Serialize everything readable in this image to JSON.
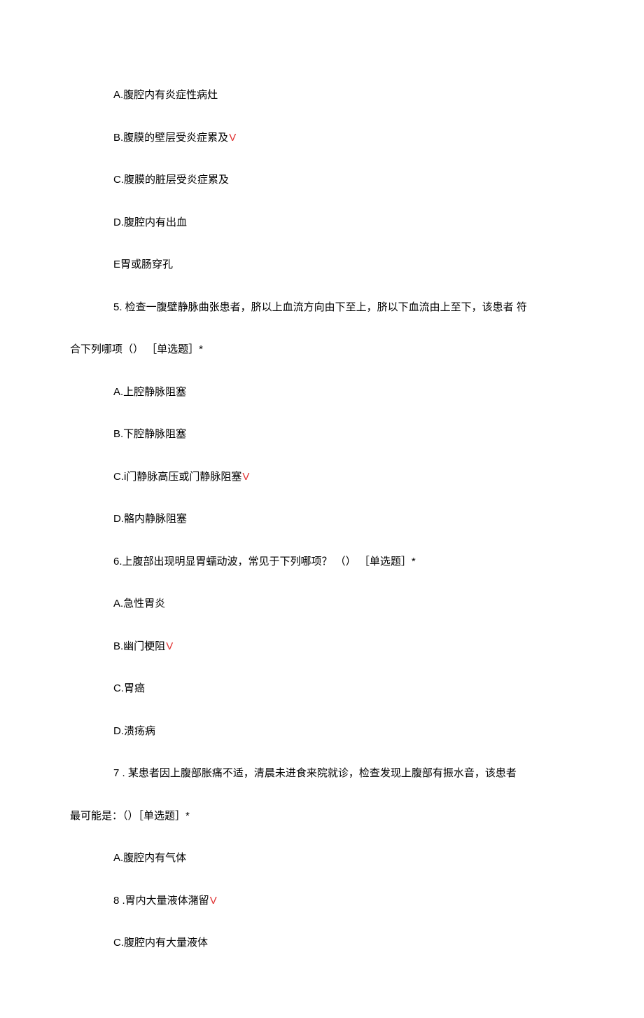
{
  "lines": [
    {
      "text": "A.腹腔内有炎症性病灶",
      "indent": true,
      "correct": false
    },
    {
      "text": "B.腹膜的壁层受炎症累及",
      "indent": true,
      "correct": true
    },
    {
      "text": "C.腹膜的脏层受炎症累及",
      "indent": true,
      "correct": false
    },
    {
      "text": "D.腹腔内有出血",
      "indent": true,
      "correct": false
    },
    {
      "text": "E胃或肠穿孔",
      "indent": true,
      "correct": false
    },
    {
      "text": "5. 检查一腹壁静脉曲张患者，脐以上血流方向由下至上，脐以下血流由上至下，该患者 符",
      "indent": true,
      "correct": false
    },
    {
      "text": "合下列哪项（） ［单选题］*",
      "indent": false,
      "correct": false
    },
    {
      "text": "A.上腔静脉阻塞",
      "indent": true,
      "correct": false
    },
    {
      "text": "B.下腔静脉阻塞",
      "indent": true,
      "correct": false
    },
    {
      "text": "C.i门静脉高压或门静脉阻塞",
      "indent": true,
      "correct": true
    },
    {
      "text": "D.骼内静脉阻塞",
      "indent": true,
      "correct": false
    },
    {
      "text": "6.上腹部出现明显胃蠕动波，常见于下列哪项？ （） ［单选题］*",
      "indent": true,
      "correct": false
    },
    {
      "text": "A.急性胃炎",
      "indent": true,
      "correct": false
    },
    {
      "text": "B.幽门梗阻",
      "indent": true,
      "correct": true
    },
    {
      "text": "C.胃癌",
      "indent": true,
      "correct": false
    },
    {
      "text": "D.溃疡病",
      "indent": true,
      "correct": false
    },
    {
      "text": "7   . 某患者因上腹部胀痛不适，清晨未进食来院就诊，检查发现上腹部有振水音，该患者",
      "indent": true,
      "correct": false
    },
    {
      "text": "最可能是：（）［单选题］*",
      "indent": false,
      "correct": false
    },
    {
      "text": "A.腹腔内有气体",
      "indent": true,
      "correct": false
    },
    {
      "text": "8        .胃内大量液体潴留",
      "indent": true,
      "correct": true
    },
    {
      "text": "C.腹腔内有大量液体",
      "indent": true,
      "correct": false
    }
  ],
  "check": "V"
}
